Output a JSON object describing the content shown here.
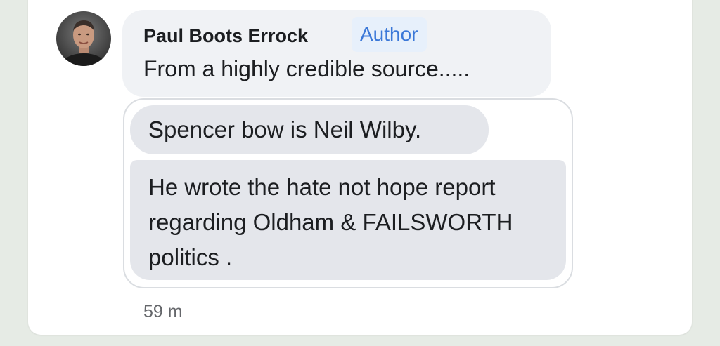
{
  "comment": {
    "author_name": "Paul Boots Errock",
    "author_badge": "Author",
    "text": "From a highly credible source.....",
    "timestamp": "59 m",
    "avatar_icon": "person-photo-avatar"
  },
  "shared_messages": {
    "message_1": "Spencer bow is Neil Wilby.",
    "message_2_lines": [
      "He wrote the hate not hope report",
      "regarding Oldham & FAILSWORTH",
      "politics ."
    ]
  },
  "colors": {
    "page_background": "#e6ebe5",
    "card_background": "#ffffff",
    "bubble_background": "#f0f2f5",
    "message_background": "#e4e6eb",
    "badge_text": "#3b78d8",
    "badge_background": "#e7f0fb",
    "primary_text": "#1c1e21",
    "secondary_text": "#65676b"
  }
}
